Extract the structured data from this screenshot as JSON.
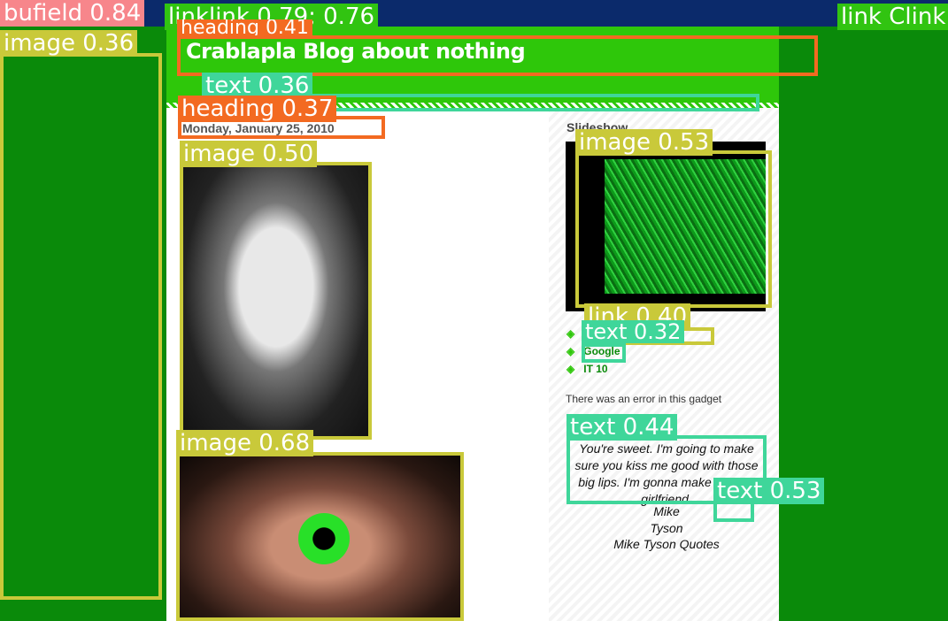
{
  "blog": {
    "title": "Crablapla Blog about nothing",
    "date": "Monday, January 25, 2010"
  },
  "sidebar": {
    "slideshow_title": "Slideshow",
    "links": [
      {
        "label": "Google"
      },
      {
        "label": "IT 10"
      }
    ],
    "gadget_error": "There was an error in this gadget",
    "quote": {
      "text": "You're sweet. I'm going to make sure you kiss me good with those big lips. I'm gonna make you my girlfriend.",
      "author_line": "Mike",
      "author_name": "Tyson",
      "source": "Mike Tyson Quotes"
    }
  },
  "detections": [
    {
      "label": "bufield 0.84"
    },
    {
      "label": "image 0.36"
    },
    {
      "label": "linklink 0.79; 0.76"
    },
    {
      "label": "heading 0.41"
    },
    {
      "label": "link Clink"
    },
    {
      "label": "text 0.36"
    },
    {
      "label": "heading 0.37"
    },
    {
      "label": "image 0.50"
    },
    {
      "label": "image 0.68"
    },
    {
      "label": "image 0.53"
    },
    {
      "label": "link 0.40"
    },
    {
      "label": "text 0.32"
    },
    {
      "label": "text 0.44"
    },
    {
      "label": "text 0.53"
    }
  ],
  "colors": {
    "header_green": "#2ec70a",
    "page_green": "#0a8a0a",
    "topbar_navy": "#0b2a6b"
  }
}
